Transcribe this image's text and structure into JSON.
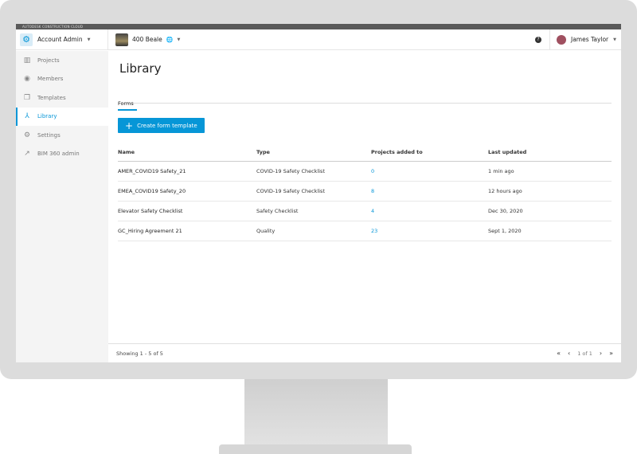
{
  "app": {
    "brand": "AUTODESK CONSTRUCTION CLOUD"
  },
  "header": {
    "account": "Account Admin",
    "project": "400 Beale",
    "user": "James Taylor",
    "help": "?"
  },
  "sidebar": {
    "items": [
      {
        "label": "Projects",
        "icon": "building-icon"
      },
      {
        "label": "Members",
        "icon": "user-circle-icon"
      },
      {
        "label": "Templates",
        "icon": "documents-icon"
      },
      {
        "label": "Library",
        "icon": "library-icon",
        "active": true
      },
      {
        "label": "Settings",
        "icon": "gear-icon"
      },
      {
        "label": "BIM 360 admin",
        "icon": "external-link-icon"
      }
    ]
  },
  "main": {
    "title": "Library",
    "tabs": [
      {
        "label": "Forms"
      }
    ],
    "create_button": "Create form template",
    "table": {
      "columns": [
        "Name",
        "Type",
        "Projects added to",
        "Last updated"
      ],
      "rows": [
        [
          "AMER_COVID19 Safety_21",
          "COVID-19 Safety Checklist",
          "0",
          "1 min ago"
        ],
        [
          "EMEA_COVID19 Safety_20",
          "COVID-19 Safety Checklist",
          "8",
          "12 hours ago"
        ],
        [
          "Elevator Safety Checklist",
          "Safety Checklist",
          "4",
          "Dec 30, 2020"
        ],
        [
          "GC_Hiring Agreement 21",
          "Quality",
          "23",
          "Sept 1, 2020"
        ]
      ]
    },
    "footer": {
      "showing": "Showing 1 - 5 of 5",
      "page": "1 of 1"
    }
  },
  "colors": {
    "accent": "#0696d7"
  }
}
